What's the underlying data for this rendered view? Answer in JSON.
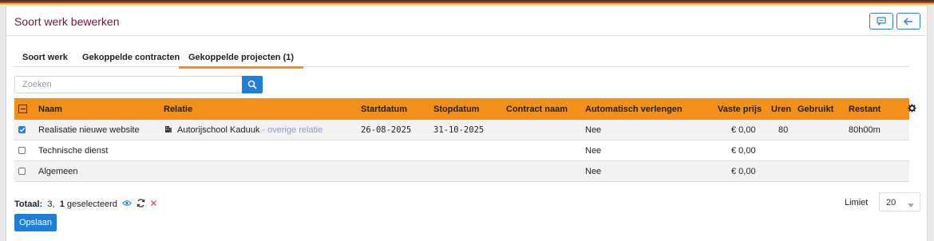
{
  "title": "Soort werk bewerken",
  "tabs": [
    {
      "label": "Soort werk"
    },
    {
      "label": "Gekoppelde contracten"
    },
    {
      "label": "Gekoppelde projecten (1)"
    }
  ],
  "search": {
    "placeholder": "Zoeken"
  },
  "columns": {
    "naam": "Naam",
    "relatie": "Relatie",
    "startdatum": "Startdatum",
    "stopdatum": "Stopdatum",
    "contract_naam": "Contract naam",
    "automatisch_verlengen": "Automatisch verlengen",
    "vaste_prijs": "Vaste prijs",
    "uren": "Uren",
    "gebruikt": "Gebruikt",
    "restant": "Restant"
  },
  "rows": [
    {
      "naam": "Realisatie nieuwe website",
      "relatie": "Autorijschool Kaduuk",
      "relatie_extra": "- overige relatie",
      "startdatum": "26-08-2025",
      "stopdatum": "31-10-2025",
      "contract_naam": "",
      "automatisch_verlengen": "Nee",
      "vaste_prijs": "€ 0,00",
      "uren": "80",
      "gebruikt": "",
      "restant": "80h00m"
    },
    {
      "naam": "Technische dienst",
      "relatie": "",
      "relatie_extra": "",
      "startdatum": "",
      "stopdatum": "",
      "contract_naam": "",
      "automatisch_verlengen": "Nee",
      "vaste_prijs": "€ 0,00",
      "uren": "",
      "gebruikt": "",
      "restant": ""
    },
    {
      "naam": "Algemeen",
      "relatie": "",
      "relatie_extra": "",
      "startdatum": "",
      "stopdatum": "",
      "contract_naam": "",
      "automatisch_verlengen": "Nee",
      "vaste_prijs": "€ 0,00",
      "uren": "",
      "gebruikt": "",
      "restant": ""
    }
  ],
  "footer": {
    "totaal_label": "Totaal:",
    "totaal_value": "3,",
    "selected_count": "1",
    "selected_label": "geselecteerd",
    "limiet_label": "Limiet",
    "limiet_value": "20"
  },
  "save_label": "Opslaan",
  "colors": {
    "accent": "#f39019",
    "primary": "#1f7fd8",
    "title": "#7a1236"
  }
}
